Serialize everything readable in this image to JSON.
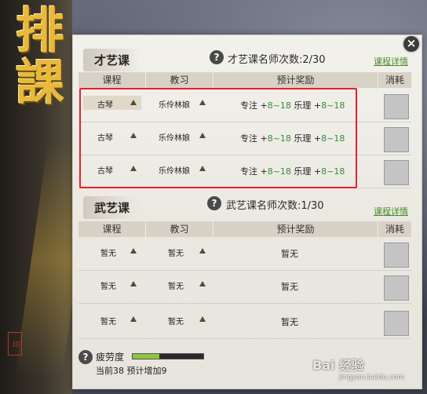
{
  "banner": {
    "title": "排課",
    "seal": "印"
  },
  "close_glyph": "×",
  "help_glyph": "?",
  "section_art": {
    "label": "才艺课",
    "limit_text": "才艺课名师次数:2/30",
    "details_link": "课程详情",
    "headers": [
      "课程",
      "教习",
      "预计奖励",
      "消耗"
    ],
    "rows": [
      {
        "course": "古琴",
        "teacher": "乐伶林娘",
        "reward_a": "专注 +",
        "reward_a_val": "8~18",
        "reward_b": " 乐理 +",
        "reward_b_val": "8~18"
      },
      {
        "course": "古琴",
        "teacher": "乐伶林娘",
        "reward_a": "专注 +",
        "reward_a_val": "8~18",
        "reward_b": " 乐理 +",
        "reward_b_val": "8~18"
      },
      {
        "course": "古琴",
        "teacher": "乐伶林娘",
        "reward_a": "专注 +",
        "reward_a_val": "8~18",
        "reward_b": " 乐理 +",
        "reward_b_val": "8~18"
      }
    ]
  },
  "section_martial": {
    "label": "武艺课",
    "limit_text": "武艺课名师次数:1/30",
    "details_link": "课程详情",
    "headers": [
      "课程",
      "教习",
      "预计奖励",
      "消耗"
    ],
    "rows": [
      {
        "course": "暂无",
        "teacher": "暂无",
        "reward": "暂无"
      },
      {
        "course": "暂无",
        "teacher": "暂无",
        "reward": "暂无"
      },
      {
        "course": "暂无",
        "teacher": "暂无",
        "reward": "暂无"
      }
    ]
  },
  "fatigue": {
    "label": "疲劳度",
    "sub_text": "当前38 预计增加9",
    "level_fraction": 0.38
  },
  "watermark": {
    "text": "Bai 经验",
    "sub": "jingyan.baidu.com"
  },
  "colors": {
    "highlight": "#e8202a",
    "reward_num": "#3a8a3a",
    "fatigue_fill": "#8cc63f",
    "link": "#4a8a2a"
  }
}
